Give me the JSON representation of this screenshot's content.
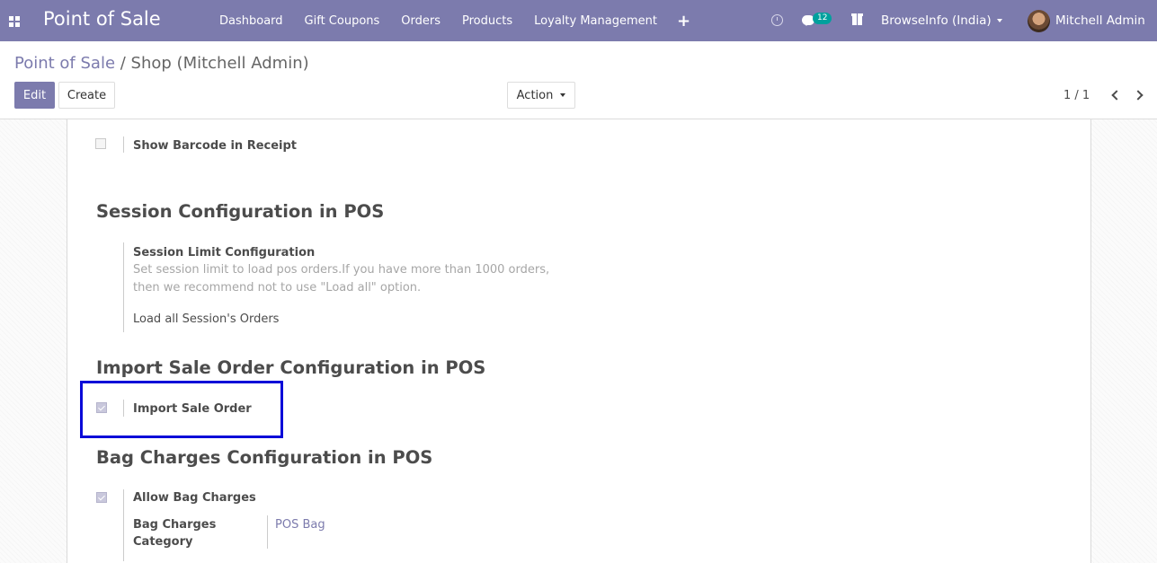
{
  "navbar": {
    "brand": "Point of Sale",
    "menu": [
      "Dashboard",
      "Gift Coupons",
      "Orders",
      "Products",
      "Loyalty Management"
    ],
    "messages_count": "12",
    "company": "BrowseInfo (India)",
    "user": "Mitchell Admin",
    "bg_color": "#7c7bad"
  },
  "control": {
    "breadcrumb_parent": "Point of Sale",
    "breadcrumb_sep": " / ",
    "breadcrumb_current": "Shop (Mitchell Admin)",
    "edit_label": "Edit",
    "create_label": "Create",
    "action_label": "Action",
    "pager": "1 / 1"
  },
  "form": {
    "barcode_label": "Show Barcode in Receipt",
    "barcode_checked": false,
    "session_heading": "Session Configuration in POS",
    "session_limit_label": "Session Limit Configuration",
    "session_limit_help": "Set session limit to load pos orders.If you have more than 1000 orders, then we recommend not to use \"Load all\" option.",
    "session_limit_value": "Load all Session's Orders",
    "import_heading": "Import Sale Order Configuration in POS",
    "import_label": "Import Sale Order",
    "import_checked": true,
    "bag_heading": "Bag Charges Configuration in POS",
    "bag_label": "Allow Bag Charges",
    "bag_checked": true,
    "bag_category_label_1": "Bag Charges",
    "bag_category_label_2": "Category",
    "bag_category_value": "POS Bag"
  }
}
